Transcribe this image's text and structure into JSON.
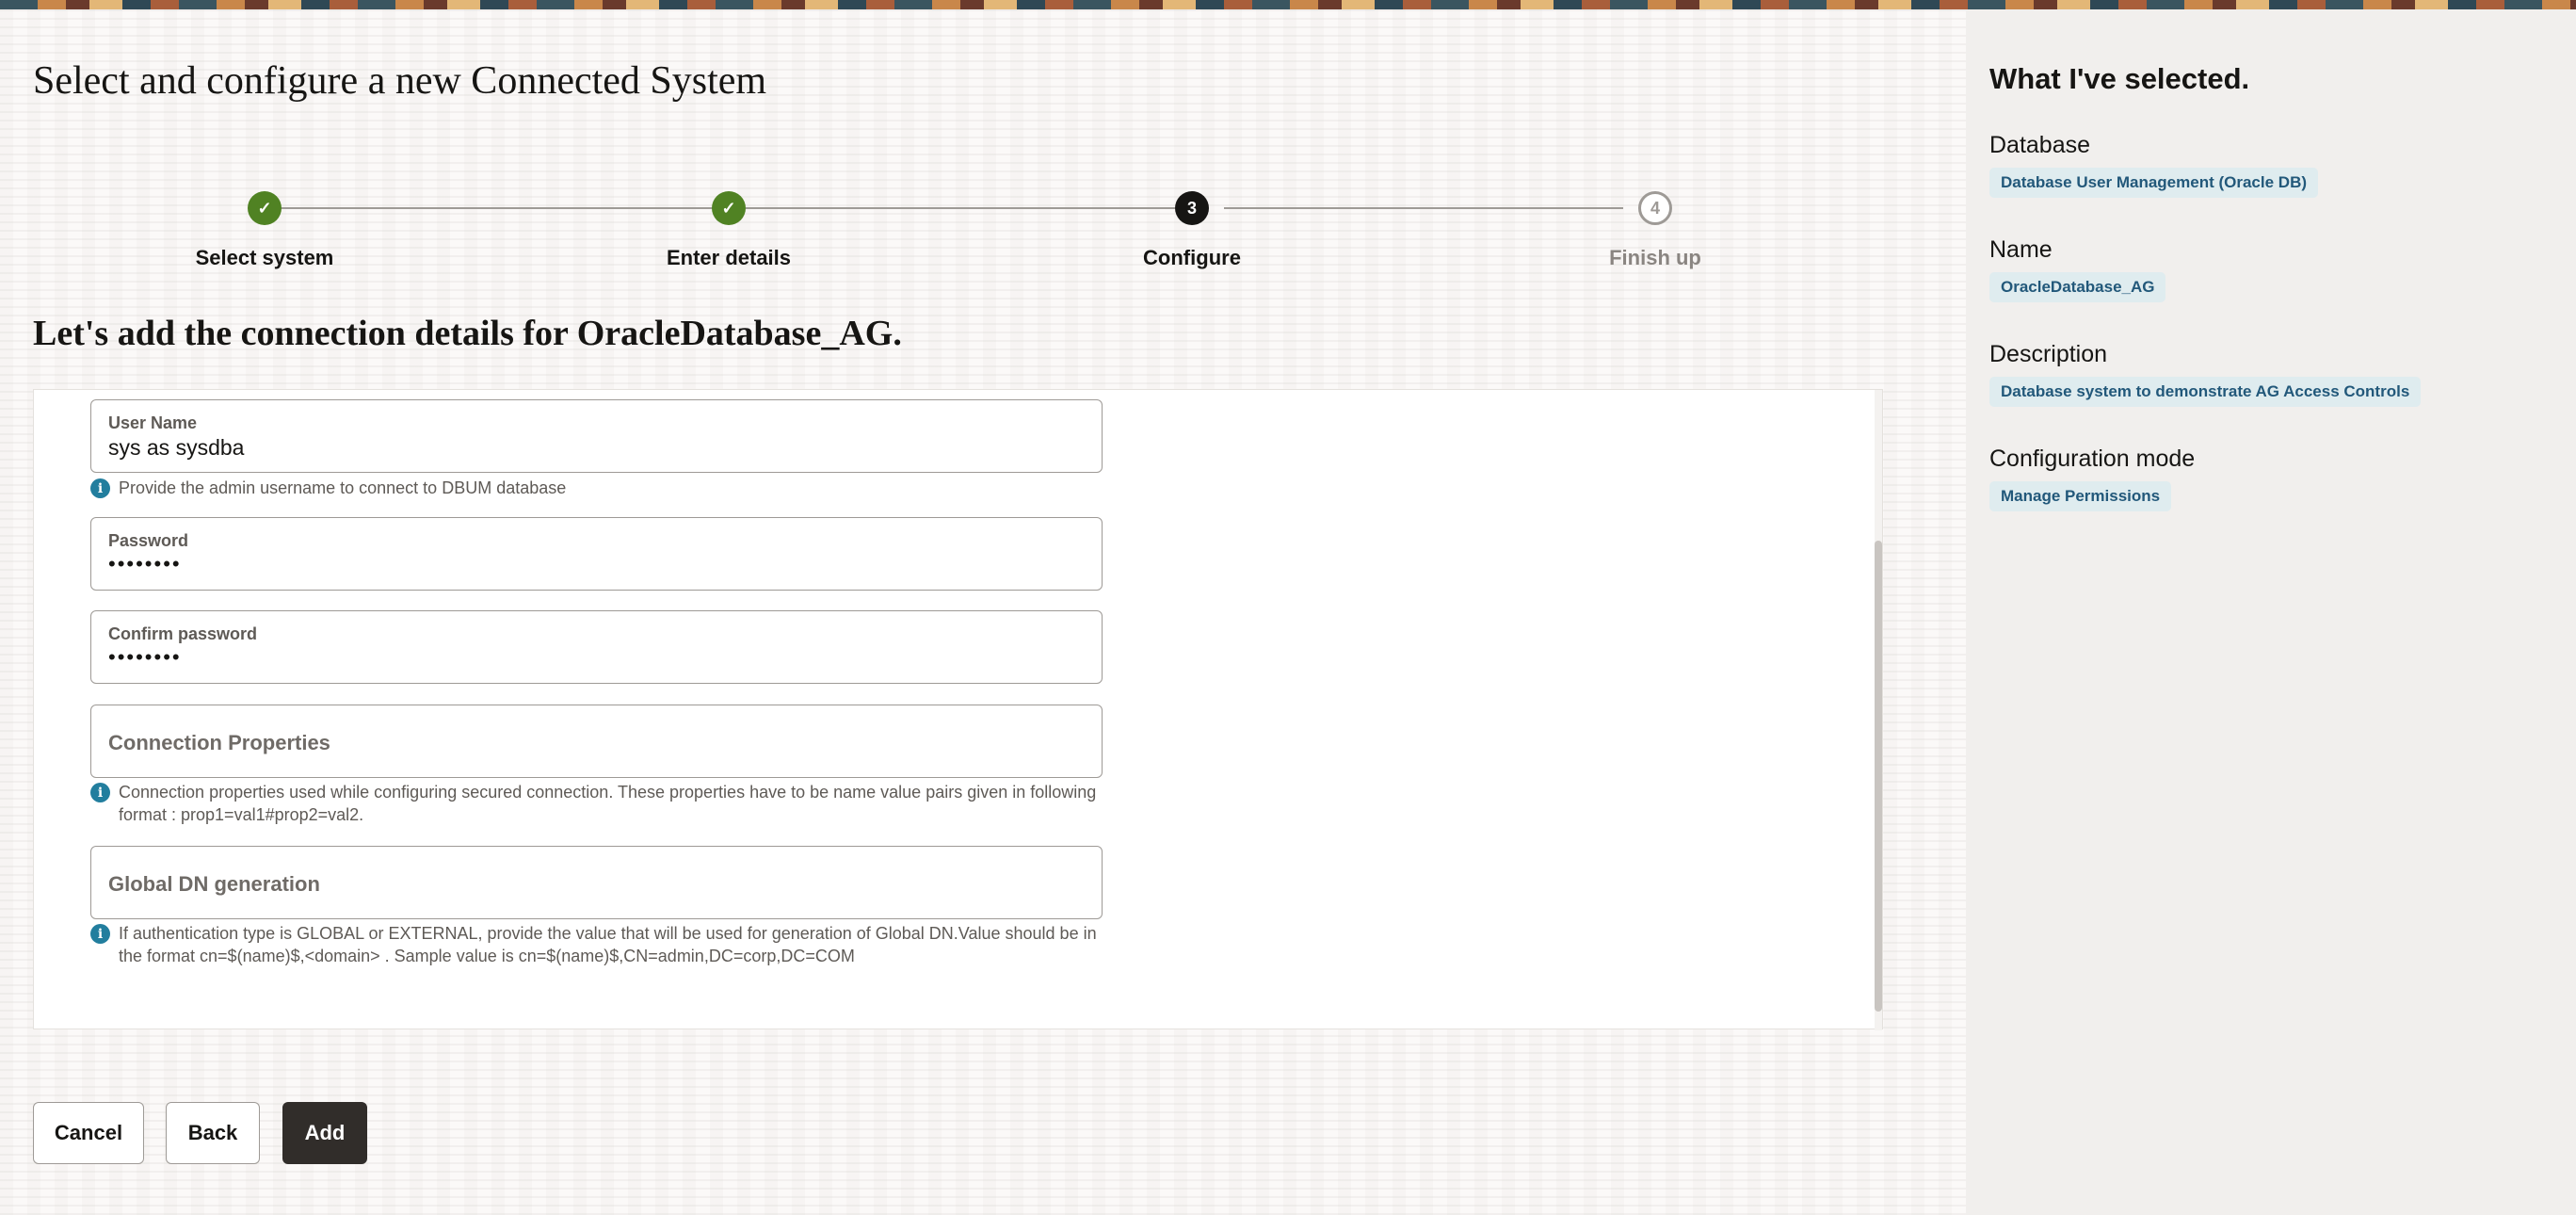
{
  "page_title": "Select and configure a new Connected System",
  "steps": [
    {
      "label": "Select system",
      "state": "done",
      "marker": "✓"
    },
    {
      "label": "Enter details",
      "state": "done",
      "marker": "✓"
    },
    {
      "label": "Configure",
      "state": "current",
      "marker": "3"
    },
    {
      "label": "Finish up",
      "state": "todo",
      "marker": "4"
    }
  ],
  "section_title": "Let's add the connection details for OracleDatabase_AG.",
  "form": {
    "username": {
      "label": "User Name",
      "value": "sys as sysdba",
      "help": "Provide the admin username to connect to DBUM database"
    },
    "password": {
      "label": "Password",
      "value": "••••••••"
    },
    "confirm_password": {
      "label": "Confirm password",
      "value": "••••••••"
    },
    "connection_properties": {
      "placeholder": "Connection Properties",
      "help": "Connection properties used while configuring secured connection. These properties have to be name value pairs given in following format : prop1=val1#prop2=val2."
    },
    "global_dn": {
      "placeholder": "Global DN generation",
      "help": "If authentication type is GLOBAL or EXTERNAL, provide the value that will be used for generation of Global DN.Value should be in the format cn=$(name)$,<domain> . Sample value is cn=$(name)$,CN=admin,DC=corp,DC=COM"
    }
  },
  "buttons": {
    "cancel": "Cancel",
    "back": "Back",
    "add": "Add"
  },
  "summary": {
    "title": "What I've selected.",
    "items": [
      {
        "label": "Database",
        "value": "Database User Management (Oracle DB)"
      },
      {
        "label": "Name",
        "value": "OracleDatabase_AG"
      },
      {
        "label": "Description",
        "value": "Database system to demonstrate AG Access Controls"
      },
      {
        "label": "Configuration mode",
        "value": "Manage Permissions"
      }
    ]
  },
  "colors": {
    "step_done": "#508223",
    "step_current": "#161513",
    "primary_button": "#312d2a",
    "badge_bg": "#dfecef",
    "badge_text": "#22587a",
    "info_icon": "#227e9e"
  }
}
